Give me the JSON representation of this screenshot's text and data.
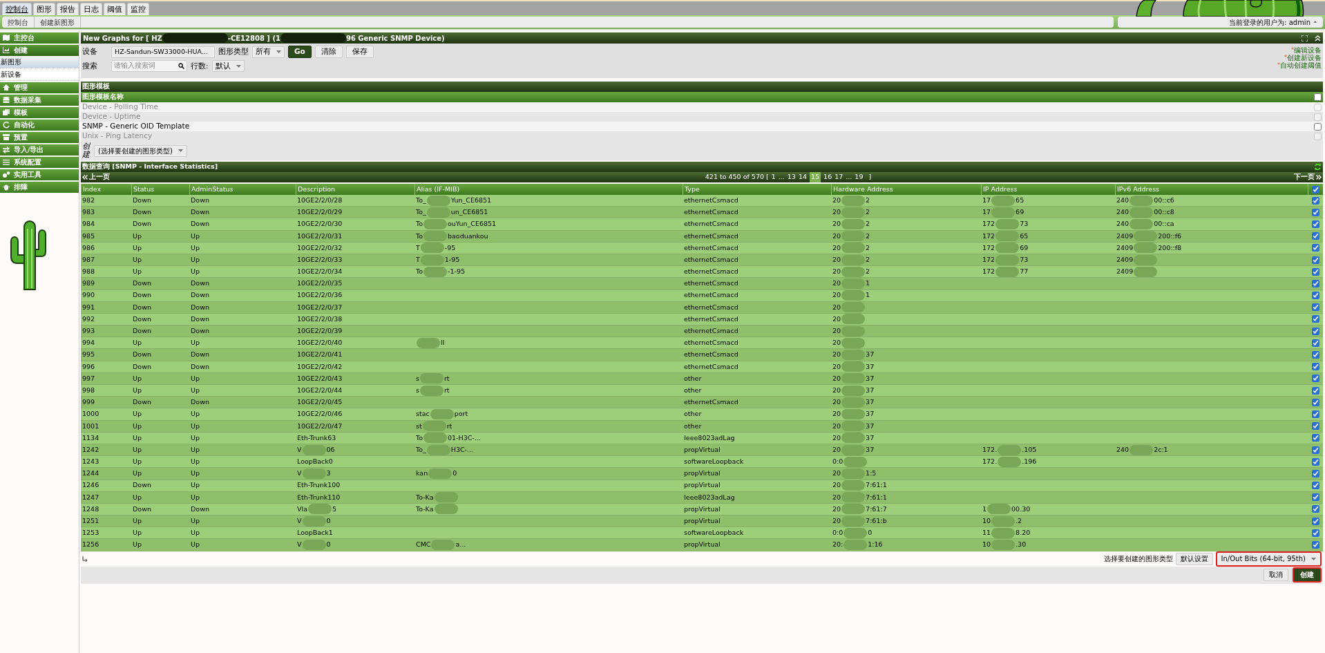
{
  "top_tabs": [
    {
      "label": "控制台",
      "selected": true
    },
    {
      "label": "图形",
      "selected": false
    },
    {
      "label": "报告",
      "selected": false
    },
    {
      "label": "日志",
      "selected": false
    },
    {
      "label": "阈值",
      "selected": false
    },
    {
      "label": "监控",
      "selected": false
    }
  ],
  "breadcrumb": [
    "控制台",
    "创建新图形"
  ],
  "user": {
    "label": "当前登录的用户为: admin",
    "caret": "⏶"
  },
  "sidebar": [
    {
      "label": "主控台",
      "expanded": false
    },
    {
      "label": "创建",
      "expanded": true,
      "children": [
        {
          "label": "新图形",
          "selected": true
        },
        {
          "label": "新设备",
          "selected": false
        }
      ]
    },
    {
      "label": "管理",
      "expanded": false
    },
    {
      "label": "数据采集",
      "expanded": false
    },
    {
      "label": "模板",
      "expanded": false
    },
    {
      "label": "自动化",
      "expanded": false
    },
    {
      "label": "预置",
      "expanded": false
    },
    {
      "label": "导入/导出",
      "expanded": false
    },
    {
      "label": "系统配置",
      "expanded": false
    },
    {
      "label": "实用工具",
      "expanded": false
    },
    {
      "label": "排障",
      "expanded": false
    }
  ],
  "panel": {
    "title_parts": [
      "New Graphs for [ HZ",
      "-CE12808 ] (1",
      "96 Generic SNMP Device)"
    ],
    "device_label": "设备",
    "device_value": "HZ-Sandun-SW33000-HUA...",
    "graph_type_label": "图形类型",
    "graph_type_value": "所有",
    "buttons": [
      "Go",
      "清除",
      "保存"
    ],
    "search_label": "搜索",
    "search_placeholder": "请输入搜索词",
    "rows_label": "行数:",
    "rows_value": "默认",
    "links": [
      {
        "mark": "*",
        "label": "编辑设备"
      },
      {
        "mark": "*",
        "label": "创建新设备"
      },
      {
        "mark": "*",
        "label": "自动创建阈值"
      }
    ]
  },
  "graph_templates": {
    "title": "图形模板",
    "column": "图形模板名称",
    "all_checked": false,
    "rows": [
      {
        "name": "Device - Polling Time",
        "disabled": true,
        "checked": false
      },
      {
        "name": "Device - Uptime",
        "disabled": true,
        "checked": false
      },
      {
        "name": "SNMP - Generic OID Template",
        "disabled": false,
        "checked": false
      },
      {
        "name": "Unix - Ping Latency",
        "disabled": true,
        "checked": false
      }
    ],
    "create_label": "创建",
    "create_select": "(选择要创建的图形类型)"
  },
  "data_query": {
    "title": "数据查询 [SNMP - Interface Statistics]",
    "prev": "上一页",
    "next": "下一页",
    "range": "421 to 450 of 570 [",
    "range_end": "]",
    "pages": [
      {
        "label": "1",
        "selected": false
      },
      {
        "label": "...",
        "selected": false
      },
      {
        "label": "13",
        "selected": false
      },
      {
        "label": "14",
        "selected": false
      },
      {
        "label": "15",
        "selected": true
      },
      {
        "label": "16",
        "selected": false
      },
      {
        "label": "17",
        "selected": false
      },
      {
        "label": "...",
        "selected": false
      },
      {
        "label": "19",
        "selected": false
      }
    ],
    "columns": [
      "Index",
      "Status",
      "AdminStatus",
      "Description",
      "Alias (IF-MIB)",
      "Type",
      "Hardware Address",
      "IP Address",
      "IPv6 Address"
    ],
    "all_checked": true,
    "rows": [
      {
        "cells": [
          "982",
          "Down",
          "Down",
          "10GE2/2/0/28",
          {
            "before": "To_",
            "after": "Yun_CE6851"
          },
          "ethernetCsmacd",
          {
            "before": "20",
            "after": "2"
          },
          {
            "before": "17",
            "after": "65"
          },
          {
            "before": "240",
            "after": "00::c6"
          }
        ],
        "checked": true
      },
      {
        "cells": [
          "983",
          "Down",
          "Down",
          "10GE2/2/0/29",
          {
            "before": "To_",
            "after": "un_CE6851"
          },
          "ethernetCsmacd",
          {
            "before": "20",
            "after": "2"
          },
          {
            "before": "17",
            "after": "69"
          },
          {
            "before": "240",
            "after": "00::c8"
          }
        ],
        "checked": true
      },
      {
        "cells": [
          "984",
          "Down",
          "Down",
          "10GE2/2/0/30",
          {
            "before": "To",
            "after": "ouYun_CE6851"
          },
          "ethernetCsmacd",
          {
            "before": "20",
            "after": "2"
          },
          {
            "before": "172",
            "after": "73"
          },
          {
            "before": "240",
            "after": "00::ca"
          }
        ],
        "checked": true
      },
      {
        "cells": [
          "985",
          "Up",
          "Up",
          "10GE2/2/0/31",
          {
            "before": "To",
            "after": "baoduankou"
          },
          "ethernetCsmacd",
          {
            "before": "20",
            "after": "2"
          },
          {
            "before": "172",
            "after": "65"
          },
          {
            "before": "2409",
            "after": "200::f6"
          }
        ],
        "checked": true
      },
      {
        "cells": [
          "986",
          "Up",
          "Up",
          "10GE2/2/0/32",
          {
            "before": "T",
            "after": "-95"
          },
          "ethernetCsmacd",
          {
            "before": "20",
            "after": "2"
          },
          {
            "before": "172",
            "after": "69"
          },
          {
            "before": "2409",
            "after": "200::f8"
          }
        ],
        "checked": true
      },
      {
        "cells": [
          "987",
          "Up",
          "Up",
          "10GE2/2/0/33",
          {
            "before": "T",
            "after": "1-95"
          },
          "ethernetCsmacd",
          {
            "before": "20",
            "after": "2"
          },
          {
            "before": "172",
            "after": "73"
          },
          {
            "before": "2409"
          }
        ],
        "checked": true
      },
      {
        "cells": [
          "988",
          "Up",
          "Up",
          "10GE2/2/0/34",
          {
            "before": "To",
            "after": "-1-95"
          },
          "ethernetCsmacd",
          {
            "before": "20",
            "after": "2"
          },
          {
            "before": "172",
            "after": "77"
          },
          {
            "before": "2409"
          }
        ],
        "checked": true
      },
      {
        "cells": [
          "989",
          "Down",
          "Down",
          "10GE2/2/0/35",
          null,
          "ethernetCsmacd",
          {
            "before": "20",
            "after": "1"
          },
          null,
          null
        ],
        "checked": true
      },
      {
        "cells": [
          "990",
          "Down",
          "Down",
          "10GE2/2/0/36",
          null,
          "ethernetCsmacd",
          {
            "before": "20",
            "after": "1"
          },
          null,
          null
        ],
        "checked": true
      },
      {
        "cells": [
          "991",
          "Down",
          "Down",
          "10GE2/2/0/37",
          null,
          "ethernetCsmacd",
          {
            "before": "20"
          },
          null,
          null
        ],
        "checked": true
      },
      {
        "cells": [
          "992",
          "Down",
          "Down",
          "10GE2/2/0/38",
          null,
          "ethernetCsmacd",
          {
            "before": "20"
          },
          null,
          null
        ],
        "checked": true
      },
      {
        "cells": [
          "993",
          "Down",
          "Down",
          "10GE2/2/0/39",
          null,
          "ethernetCsmacd",
          {
            "before": "20"
          },
          null,
          null
        ],
        "checked": true
      },
      {
        "cells": [
          "994",
          "Up",
          "Up",
          "10GE2/2/0/40",
          {
            "after": "ll"
          },
          "ethernetCsmacd",
          {
            "before": "20"
          },
          null,
          null
        ],
        "checked": true
      },
      {
        "cells": [
          "995",
          "Down",
          "Down",
          "10GE2/2/0/41",
          null,
          "ethernetCsmacd",
          {
            "before": "20",
            "after": "37"
          },
          null,
          null
        ],
        "checked": true
      },
      {
        "cells": [
          "996",
          "Down",
          "Down",
          "10GE2/2/0/42",
          null,
          "ethernetCsmacd",
          {
            "before": "20",
            "after": "37"
          },
          null,
          null
        ],
        "checked": true
      },
      {
        "cells": [
          "997",
          "Up",
          "Up",
          "10GE2/2/0/43",
          {
            "before": "s",
            "after": "rt"
          },
          "other",
          {
            "before": "20",
            "after": "37"
          },
          null,
          null
        ],
        "checked": true
      },
      {
        "cells": [
          "998",
          "Up",
          "Up",
          "10GE2/2/0/44",
          {
            "before": "s",
            "after": "rt"
          },
          "other",
          {
            "before": "20",
            "after": "37"
          },
          null,
          null
        ],
        "checked": true
      },
      {
        "cells": [
          "999",
          "Down",
          "Down",
          "10GE2/2/0/45",
          null,
          "ethernetCsmacd",
          {
            "before": "20",
            "after": "37"
          },
          null,
          null
        ],
        "checked": true
      },
      {
        "cells": [
          "1000",
          "Up",
          "Up",
          "10GE2/2/0/46",
          {
            "before": "stac",
            "after": "port"
          },
          "other",
          {
            "before": "20",
            "after": "37"
          },
          null,
          null
        ],
        "checked": true
      },
      {
        "cells": [
          "1001",
          "Up",
          "Up",
          "10GE2/2/0/47",
          {
            "before": "st",
            "after": "rt"
          },
          "other",
          {
            "before": "20",
            "after": "37"
          },
          null,
          null
        ],
        "checked": true
      },
      {
        "cells": [
          "1134",
          "Up",
          "Up",
          "Eth-Trunk63",
          {
            "before": "To",
            "after": "01-H3C-..."
          },
          "Ieee8023adLag",
          {
            "before": "20",
            "after": "37"
          },
          null,
          null
        ],
        "checked": true
      },
      {
        "cells": [
          "1242",
          "Up",
          "Up",
          {
            "before": "V",
            "after": "06"
          },
          {
            "before": "To_",
            "after": "H3C-..."
          },
          "propVirtual",
          {
            "before": "20",
            "after": "37"
          },
          {
            "before": "172.",
            "after": ".105"
          },
          {
            "before": "240",
            "after": "2c:1"
          }
        ],
        "checked": true
      },
      {
        "cells": [
          "1243",
          "Up",
          "Up",
          "LoopBack0",
          null,
          "softwareLoopback",
          {
            "before": "0:0"
          },
          {
            "before": "172.",
            "after": ".196"
          },
          null
        ],
        "checked": true
      },
      {
        "cells": [
          "1244",
          "Up",
          "Up",
          {
            "before": "V",
            "after": "3"
          },
          {
            "before": "kan",
            "after": "0"
          },
          "propVirtual",
          {
            "before": "20",
            "after": "1:5"
          },
          null,
          null
        ],
        "checked": true
      },
      {
        "cells": [
          "1246",
          "Down",
          "Up",
          "Eth-Trunk100",
          null,
          "propVirtual",
          {
            "before": "20",
            "after": "7:61:1"
          },
          null,
          null
        ],
        "checked": true
      },
      {
        "cells": [
          "1247",
          "Up",
          "Up",
          "Eth-Trunk110",
          {
            "before": "To-Ka"
          },
          "Ieee8023adLag",
          {
            "before": "20",
            "after": "7:61:1"
          },
          null,
          null
        ],
        "checked": true
      },
      {
        "cells": [
          "1248",
          "Down",
          "Down",
          {
            "before": "Vla",
            "after": "5"
          },
          {
            "before": "To-Ka"
          },
          "propVirtual",
          {
            "before": "20",
            "after": "7:61:7"
          },
          {
            "before": "1",
            "after": "00.30"
          },
          null
        ],
        "checked": true
      },
      {
        "cells": [
          "1251",
          "Up",
          "Up",
          {
            "before": "V",
            "after": "0"
          },
          null,
          "propVirtual",
          {
            "before": "20",
            "after": "7:61:b"
          },
          {
            "before": "10",
            "after": ".2"
          },
          null
        ],
        "checked": true
      },
      {
        "cells": [
          "1253",
          "Up",
          "Up",
          "LoopBack1",
          null,
          "softwareLoopback",
          {
            "before": "0:0",
            "after": "0"
          },
          {
            "before": "11",
            "after": "8.20"
          },
          null
        ],
        "checked": true
      },
      {
        "cells": [
          "1256",
          "Up",
          "Up",
          {
            "before": "V",
            "after": "0"
          },
          {
            "before": "CMC",
            "after": "a..."
          },
          "propVirtual",
          {
            "before": "20:",
            "after": "1:16"
          },
          {
            "before": "10",
            "after": ".30"
          },
          null
        ],
        "checked": true
      }
    ]
  },
  "footer": {
    "type_label": "选择要创建的图形类型",
    "default_button": "默认设置",
    "type_select": "In/Out Bits (64-bit, 95th)",
    "cancel": "取消",
    "create": "创建"
  }
}
